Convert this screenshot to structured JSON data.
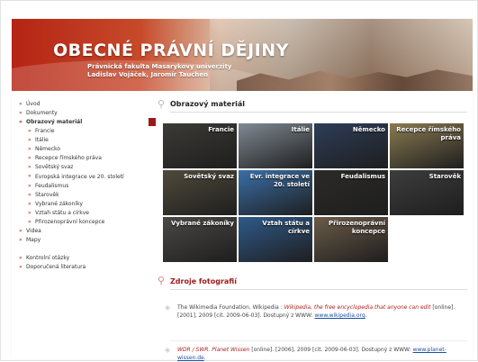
{
  "header": {
    "title": "OBECNÉ PRÁVNÍ DĚJINY",
    "subtitle_line1": "Právnická fakulta Masarykovy univerzity",
    "subtitle_line2": "Ladislav Vojáček, Jaromír Tauchen"
  },
  "sidebar": {
    "items": [
      {
        "label": "Úvod"
      },
      {
        "label": "Dokumenty"
      },
      {
        "label": "Obrazový materiál"
      },
      {
        "label": "Francie"
      },
      {
        "label": "Itálie"
      },
      {
        "label": "Německo"
      },
      {
        "label": "Recepce římského práva"
      },
      {
        "label": "Sovětský svaz"
      },
      {
        "label": "Evropská integrace ve 20. století"
      },
      {
        "label": "Feudalismus"
      },
      {
        "label": "Starověk"
      },
      {
        "label": "Vybrané zákoníky"
      },
      {
        "label": "Vztah státu a církve"
      },
      {
        "label": "Přirozenoprávní koncepce"
      },
      {
        "label": "Videa"
      },
      {
        "label": "Mapy"
      },
      {
        "label": "Kontrolní otázky"
      },
      {
        "label": "Doporučená literatura"
      }
    ]
  },
  "main": {
    "heading": "Obrazový materiál",
    "tiles": [
      {
        "label": "Francie",
        "color": "#3b3a36"
      },
      {
        "label": "Itálie",
        "color": "#7f8a93"
      },
      {
        "label": "Německo",
        "color": "#2d3d58"
      },
      {
        "label": "Recepce římského práva",
        "color": "#8a7a52"
      },
      {
        "label": "Sovětský svaz",
        "color": "#4f4a3a"
      },
      {
        "label": "Evr. integrace ve 20. století",
        "color": "#3a6fa8"
      },
      {
        "label": "Feudalismus",
        "color": "#2b2a28"
      },
      {
        "label": "Starověk",
        "color": "#3d3d3d"
      },
      {
        "label": "Vybrané zákoníky",
        "color": "#4b4845"
      },
      {
        "label": "Vztah státu a církve",
        "color": "#2f5a8a"
      },
      {
        "label": "Přirozenoprávní koncepce",
        "color": "#6b5b49"
      }
    ],
    "sources_heading": "Zdroje fotografií",
    "refs": [
      {
        "text1": "The Wikimedia Foundation. Wikipedia : ",
        "em": "Wikipedia, the free encyclopedia that anyone can edit",
        "text2": " [online]. [2001], 2009 [cit. 2009-06-03]. Dostupný z WWW: ",
        "url": "www.wikipedia.org",
        "text3": "."
      },
      {
        "em": "WDR / SWR. Planet Wissen",
        "text2": " [online]. [2006], 2009 [cit. 2009-06-03]. Dostupný z WWW: ",
        "url": "www.planet-wissen.de",
        "text3": "."
      }
    ]
  }
}
